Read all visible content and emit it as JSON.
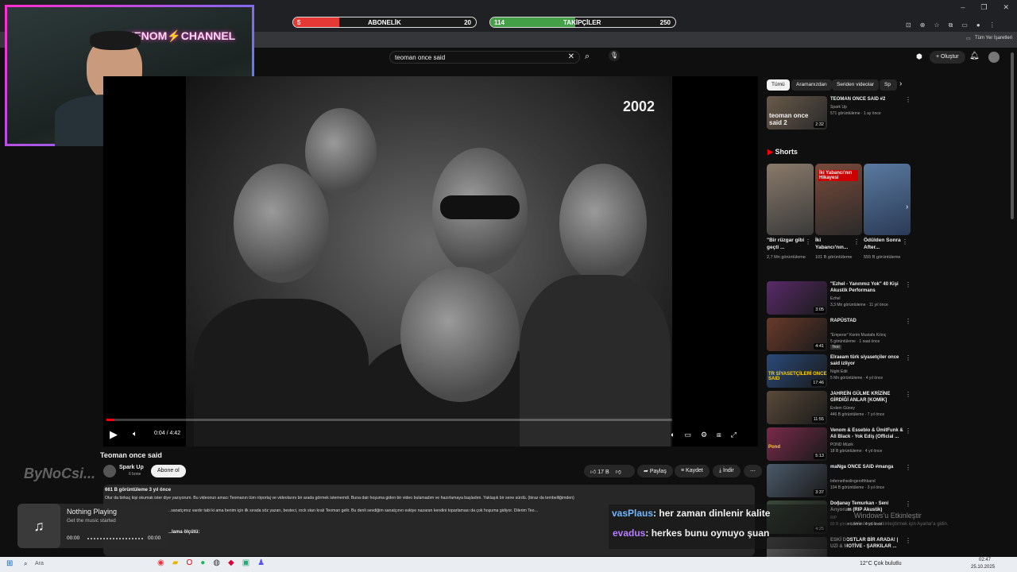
{
  "overlay": {
    "subs_bar": {
      "current": "5",
      "label": "ABONELİK",
      "goal": "20",
      "fill_fraction": 0.25,
      "color": "#e53935"
    },
    "follow_bar": {
      "current": "114",
      "label": "TAKİPÇİLER",
      "goal": "250",
      "fill_fraction": 0.46,
      "color": "#43a047"
    },
    "brand_logo": "ByNoCsi...",
    "music": {
      "title": "Nothing Playing",
      "subtitle": "Get the music started",
      "time_start": "00:00",
      "time_end": "00:00"
    },
    "chat": [
      {
        "user": "vasPlaus",
        "message": ": her zaman dinlenir kalite",
        "user_color": "#6fb8ff"
      },
      {
        "user": "evadus",
        "message": ": herkes bunu oynuyo şuan",
        "user_color": "#b77dff"
      }
    ],
    "watermark_title": "Windows'u Etkinleştir",
    "watermark_sub": "Windows'u etkinleştirmek için Ayarlar'a gidin."
  },
  "browser": {
    "bookmarks_label": "Tüm Yer İşaretleri",
    "window_controls": [
      "–",
      "❐",
      "✕"
    ]
  },
  "youtube": {
    "search_value": "teoman once said",
    "create_label": "Oluştur",
    "video": {
      "overlay_year": "2002",
      "time": "0:04 / 4:42",
      "progress_fraction": 0.014,
      "title": "Teoman once said",
      "channel": "Spark Up",
      "subscribers": "6 bone",
      "subscribe_label": "Abone ol",
      "likes": "17 B",
      "share_label": "Paylaş",
      "save_label": "Kaydet",
      "download_label": "İndir",
      "views_line": "661 B görüntüleme  3 yıl önce",
      "desc_line1": "Olur da birkaç kişi okumak ister diye yazıyorum. Bu videonun amacı Teomanın tüm röportaj ve videolarını bir arada görmek istememdi. Buna dair hoşuma giden bir video bulamadım ve hazırlamaya başladım. Yaklaşık bir sene sürdü. (biraz da tembelliğimden)",
      "desc_line2": "…sanatçımız vardır tabi ki ama benim için ilk sırada söz yazarı, besteci, rock starı kralı Teoman gelir. Bu denli sevdiğim sanatçının eskiye nazaran kendini toparlaması da çok hoşuma gidiyor. Dilerim Teo…",
      "desc_line3": "…lama ölçütü:"
    },
    "chips": [
      "Tümü",
      "Aramanızdan",
      "Seriden videolar",
      "Sp"
    ],
    "shorts_heading": "Shorts",
    "first_rec": {
      "title": "TEOMAN ONCE SAID #2",
      "channel": "Spark Up",
      "meta": "571 görüntüleme · 1 ay önce",
      "duration": "2:32",
      "thumb_text": "teoman once said 2"
    },
    "shorts": [
      {
        "title": "\"Bir rüzgar gibi geçti ...",
        "views": "2,7 Mn görüntüleme"
      },
      {
        "title": "İki Yabancı'nın...",
        "views": "101 B görüntüleme",
        "thumb_text": "İki Yabancı'nın Hikayesi"
      },
      {
        "title": "Ödülden Sonra After...",
        "views": "555 B görüntüleme"
      }
    ],
    "recs": [
      {
        "title": "\"Ezhel - Yanınmız Yok\" 40 Kişi Akustik Performans",
        "channel": "Ezhel",
        "meta": "3,3 Mn görüntüleme · 11 yıl önce",
        "duration": "3:05"
      },
      {
        "title": "RAPÜSTAD",
        "channel": "\"Emperor\" Kerim Mustafa Kılınç",
        "meta": "5 görüntüleme · 1 saat önce",
        "badge": "Yeni",
        "duration": "4:41"
      },
      {
        "title": "Elraeam türk siyasetçiler once said izliyor",
        "channel": "Night Edit",
        "meta": "5 Mn görüntüleme · 4 yıl önce",
        "duration": "17:46",
        "thumb_text": "TR SİYASETÇİLERİ ONCE SAID"
      },
      {
        "title": "JAHREİN GÜLME KRİZİNE GİRDİĞİ ANLAR [KOMİK]",
        "channel": "Erdem Güney",
        "meta": "446 B görüntüleme · 7 yıl önce",
        "duration": "11:55"
      },
      {
        "title": "Venom & Essebio & ÜmitFunk & Ali Black - Yok Ediş (Official ...",
        "channel": "POND Müzik",
        "meta": "18 B görüntüleme · 4 yıl önce",
        "duration": "5:13",
        "thumb_text": "Pond"
      },
      {
        "title": "maNga ONCE SAID #manga",
        "channel": "Infernetheslingerofthband",
        "meta": "104 B görüntüleme · 3 yıl önce",
        "duration": "3:37"
      },
      {
        "title": "Doğanay Temurkan - Seni Arıyorum (RIP Akustik)",
        "channel": "RIP",
        "meta": "89 B görüntüleme · 4 yıl önce",
        "duration": "4:25"
      },
      {
        "title": "ESKİ DOSTLAR BİR ARADA! | UZI & MOTİVE - ŞARKILAR ...",
        "channel": "",
        "meta": "",
        "duration": ""
      }
    ]
  },
  "taskbar": {
    "search": "Ara",
    "weather": "12°C  Çok bulutlu",
    "time": "02:47",
    "date": "25.10.2025"
  },
  "colors": {
    "accent_red": "#ff0000",
    "bg": "#0f0f0f"
  }
}
